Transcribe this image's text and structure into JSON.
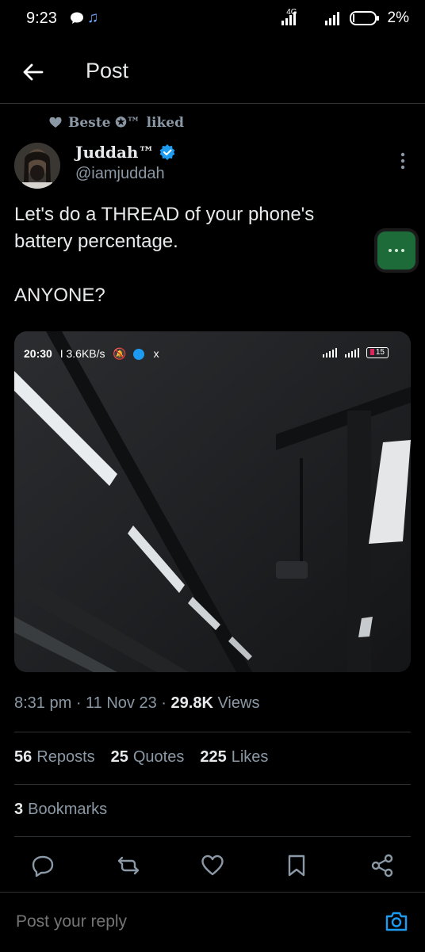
{
  "status_bar": {
    "time": "9:23",
    "network": "4G",
    "battery": "2%"
  },
  "header": {
    "title": "Post"
  },
  "liked_by": {
    "name": "Beste ✪™",
    "action": "liked"
  },
  "author": {
    "name": "Juddah™",
    "handle": "@iamjuddah",
    "verified": true
  },
  "tweet": {
    "text": "Let's do a THREAD of your phone's\nbattery percentage.\n\nANYONE?"
  },
  "media": {
    "status_time": "20:30",
    "status_speed": "I 3.6KB/s",
    "status_x": "x",
    "battery": "15"
  },
  "meta": {
    "time": "8:31 pm",
    "date": "11 Nov 23",
    "views_count": "29.8K",
    "views_label": "Views"
  },
  "stats": {
    "reposts_count": "56",
    "reposts_label": "Reposts",
    "quotes_count": "25",
    "quotes_label": "Quotes",
    "likes_count": "225",
    "likes_label": "Likes",
    "bookmarks_count": "3",
    "bookmarks_label": "Bookmarks"
  },
  "reply": {
    "placeholder": "Post your reply"
  },
  "colors": {
    "accent": "#1d9bf0",
    "muted": "#8b98a5",
    "background": "#000000"
  }
}
